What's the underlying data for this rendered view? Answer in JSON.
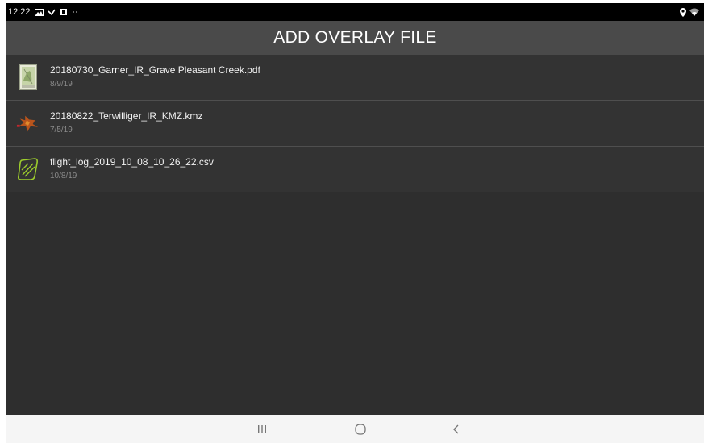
{
  "statusbar": {
    "time": "12:22",
    "icons_left": [
      "gallery-icon",
      "check-icon",
      "photo-icon",
      "more-dots-icon"
    ],
    "icons_right": [
      "location-icon",
      "wifi-icon"
    ]
  },
  "appbar": {
    "title": "ADD OVERLAY FILE"
  },
  "files": [
    {
      "name": "20180730_Garner_IR_Grave Pleasant Creek.pdf",
      "date": "8/9/19",
      "icon": "pdf-map-thumbnail-icon"
    },
    {
      "name": "20180822_Terwilliger_IR_KMZ.kmz",
      "date": "7/5/19",
      "icon": "kmz-overlay-icon"
    },
    {
      "name": "flight_log_2019_10_08_10_26_22.csv",
      "date": "10/8/19",
      "icon": "flight-log-icon"
    }
  ],
  "navbar": {
    "buttons": [
      "recent-apps-icon",
      "home-icon",
      "back-icon"
    ]
  },
  "colors": {
    "background": "#2e2e2e",
    "appbar": "#4a4a4a",
    "row": "#333333",
    "divider": "#4f4f4f",
    "accent_green": "#9ccc2c",
    "statusbar": "#000000",
    "navbar": "#f5f5f5"
  }
}
